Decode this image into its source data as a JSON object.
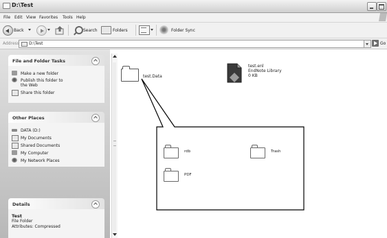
{
  "window": {
    "title": "D:\\Test"
  },
  "menu": [
    "File",
    "Edit",
    "View",
    "Favorites",
    "Tools",
    "Help"
  ],
  "toolbar": {
    "back": "Back",
    "search": "Search",
    "folders": "Folders",
    "folder_sync": "Folder Sync"
  },
  "address": {
    "label": "Address",
    "value": "D:\\Test",
    "go": "Go"
  },
  "tasks_panel": {
    "title": "File and Folder Tasks",
    "items": [
      "Make a new folder",
      "Publish this folder to",
      "the Web",
      "Share this folder"
    ]
  },
  "places_panel": {
    "title": "Other Places",
    "items": [
      "DATA (D:)",
      "My Documents",
      "Shared Documents",
      "My Computer",
      "My Network Places"
    ]
  },
  "details_panel": {
    "title": "Details",
    "name": "Test",
    "type": "File Folder",
    "attributes": "Attributes: Compressed"
  },
  "files": {
    "folder": "test.Data",
    "library": {
      "name": "test.enl",
      "type": "EndNote Library",
      "size": "0 KB"
    }
  },
  "zoom": {
    "folders": [
      "rdb",
      "Trash",
      "PDF"
    ]
  }
}
